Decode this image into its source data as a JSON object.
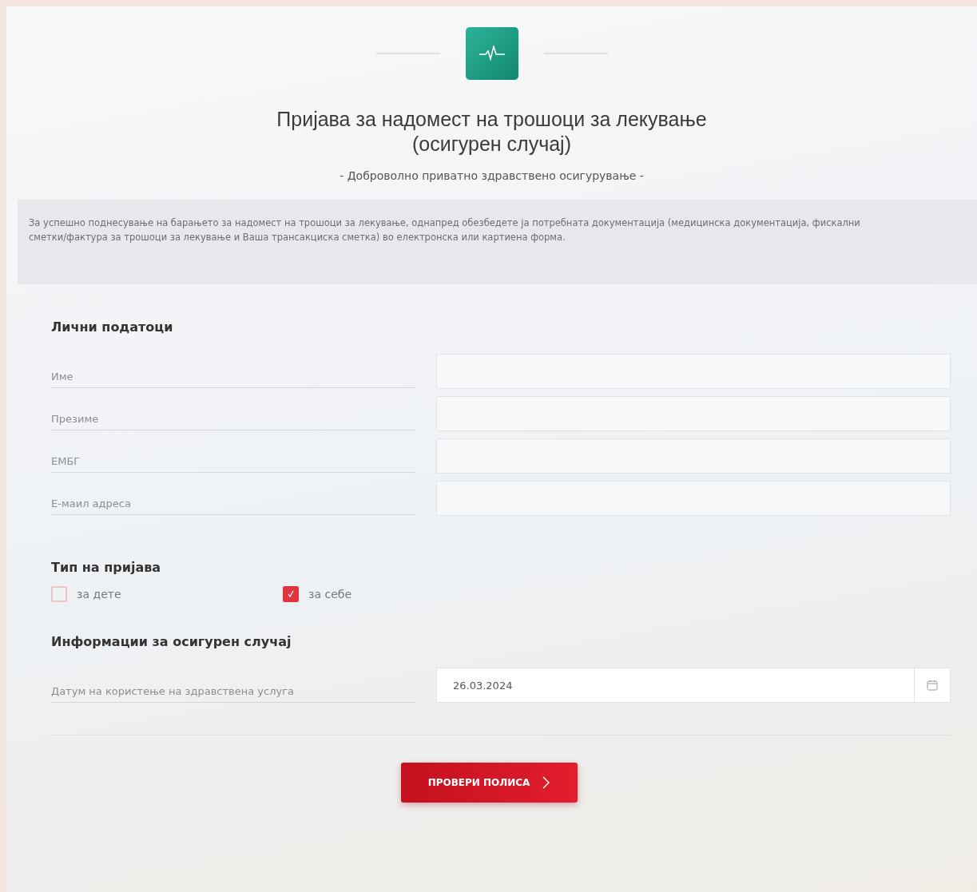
{
  "header": {
    "title_lines": [
      "Пријава за надомест на трошоци за лекување",
      "(осигурен случај)"
    ],
    "subtitle": "- Доброволно приватно здравствено осигурување -"
  },
  "notice": "За успешно поднесување на барањето за надомест на трошоци за лекување, однапред обезбедете ја потребната документација (медицинска документација, фискални сметки/фактура за трошоци за лекување и Ваша трансакциска сметка) во електронска или картиена форма.",
  "personal": {
    "heading": "Лични податоци",
    "fields": [
      {
        "label": "Име"
      },
      {
        "label": "Презиме"
      },
      {
        "label": "ЕМБГ"
      },
      {
        "label": "Е-маил адреса"
      }
    ]
  },
  "type": {
    "heading": "Тип на пријава",
    "options": [
      {
        "label": "за дете",
        "checked": false
      },
      {
        "label": "за себе",
        "checked": true
      }
    ]
  },
  "case": {
    "heading": "Информации за осигурен случај",
    "fields": [
      {
        "label": "Датум на користење на здравствена услуга",
        "value": "26.03.2024",
        "kind": "date"
      }
    ]
  },
  "submit": {
    "label": "ПРОВЕРИ ПОЛИСА"
  }
}
